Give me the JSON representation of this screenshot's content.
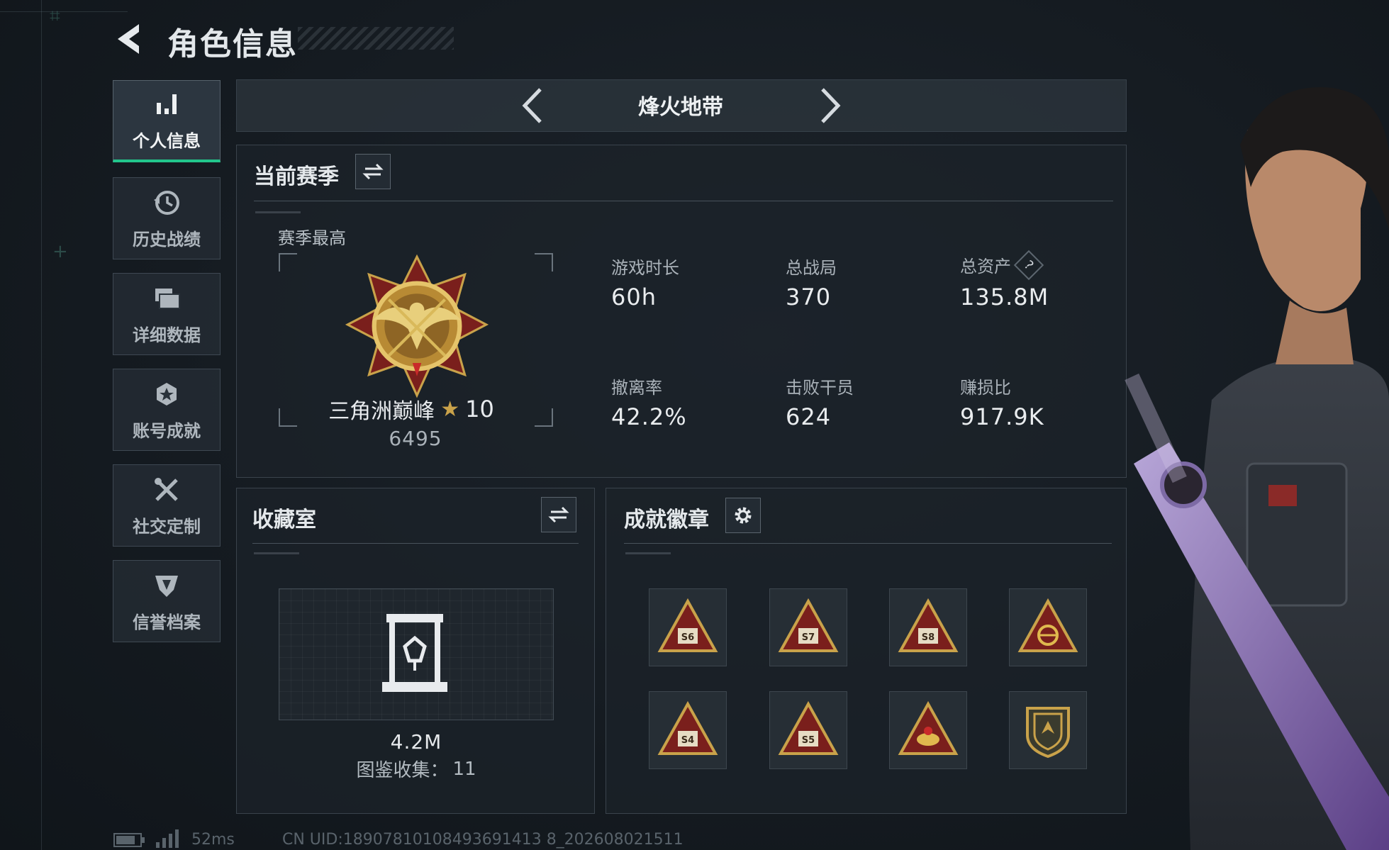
{
  "header": {
    "title": "角色信息"
  },
  "sidebar": {
    "items": [
      {
        "label": "个人信息",
        "icon": "bar-chart-icon",
        "active": true
      },
      {
        "label": "历史战绩",
        "icon": "history-clock-icon",
        "active": false
      },
      {
        "label": "详细数据",
        "icon": "folder-stack-icon",
        "active": false
      },
      {
        "label": "账号成就",
        "icon": "achievement-star-icon",
        "active": false
      },
      {
        "label": "社交定制",
        "icon": "tools-icon",
        "active": false
      },
      {
        "label": "信誉档案",
        "icon": "reputation-shield-icon",
        "active": false
      }
    ]
  },
  "mode": {
    "title": "烽火地带"
  },
  "season": {
    "title": "当前赛季",
    "best_label": "赛季最高",
    "rank_name": "三角洲巅峰",
    "rank_stars": "10",
    "rank_score": "6495",
    "stats": [
      {
        "label": "游戏时长",
        "value": "60h"
      },
      {
        "label": "总战局",
        "value": "370"
      },
      {
        "label": "总资产",
        "value": "135.8M",
        "help": "?"
      },
      {
        "label": "撤离率",
        "value": "42.2%"
      },
      {
        "label": "击败干员",
        "value": "624"
      },
      {
        "label": "赚损比",
        "value": "917.9K"
      }
    ]
  },
  "collection": {
    "title": "收藏室",
    "value": "4.2M",
    "catalog_label": "图鉴收集：",
    "catalog_count": "11"
  },
  "achievements": {
    "title": "成就徽章",
    "badges": [
      {
        "icon": "season-badge-icon",
        "label": "S6"
      },
      {
        "icon": "season-badge-icon",
        "label": "S7"
      },
      {
        "icon": "season-badge-icon",
        "label": "S8"
      },
      {
        "icon": "emblem-badge-icon",
        "label": ""
      },
      {
        "icon": "season-badge-icon",
        "label": "S4"
      },
      {
        "icon": "season-badge-icon",
        "label": "S5"
      },
      {
        "icon": "emblem-badge-icon",
        "label": ""
      },
      {
        "icon": "shield-badge-icon",
        "label": ""
      }
    ]
  },
  "status_bar": {
    "ping": "52ms",
    "uid": "CN UID:18907810108493691413 8_202608021511"
  },
  "colors": {
    "accent": "#22c68c",
    "gold": "#c9a24a",
    "badge_red": "#7a1f1c"
  }
}
